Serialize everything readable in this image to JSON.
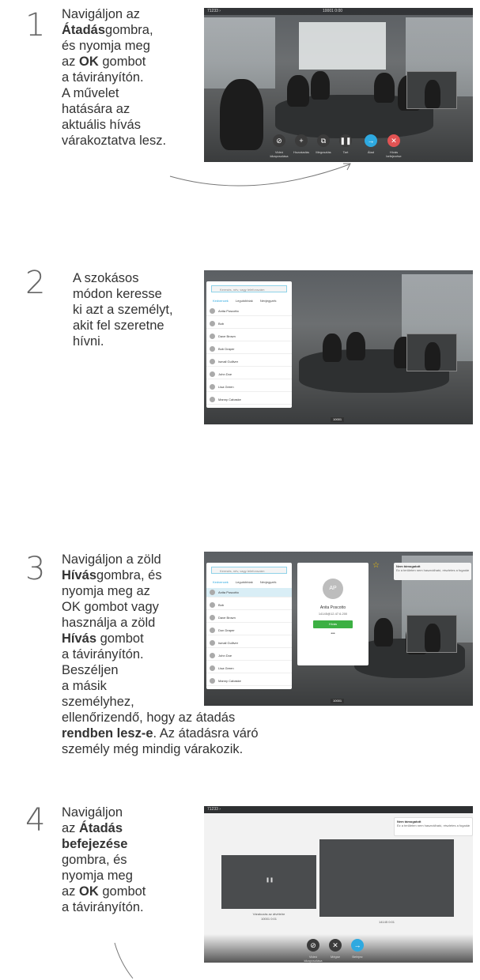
{
  "steps": [
    {
      "number": "1",
      "lines": [
        "Navigáljon az",
        "Átadásgombra,",
        "és nyomja meg",
        "az OK gombot",
        "a távirányítón.",
        "A művelet",
        "hatására az",
        "aktuális hívás",
        "várakoztatva lesz."
      ],
      "bold": {
        "l1": "Átadás",
        "l1rest": "gombra,",
        "l3pre": "az ",
        "l3b": "OK",
        "l3post": " gombot"
      },
      "screen": {
        "top_left": "71233 ›",
        "top_center": "10001  0:00",
        "controls": [
          "Videó kikapcsolása",
          "Hozzáadás",
          "Megosztás",
          "Tart",
          "Átad",
          "Hívás befejezése"
        ]
      }
    },
    {
      "number": "2",
      "lines": [
        "A szokásos",
        "módon keresse",
        "ki azt a személyt,",
        "akit fel szeretne",
        "hívni."
      ],
      "screen": {
        "search_placeholder": "Keresés, név, vagy telefonszám",
        "tabs": [
          "Kedvencek",
          "Legutóbbiak",
          "Névjegyzék"
        ],
        "contacts": [
          "Anita Poscotto",
          "Bob",
          "Dave Brown",
          "Bob Draper",
          "Ismail Gulliver",
          "John Doe",
          "Lisa Green",
          "Manny Cabaske"
        ],
        "bottom_tag": "10001"
      }
    },
    {
      "number": "3",
      "lines": [
        "Navigáljon a zöld",
        "Hívásgombra, és",
        "nyomja meg az",
        "OK gombot vagy",
        "használja a zöld",
        "Hívás gombot",
        "a távirányítón.",
        "Beszéljen",
        "a másik",
        "személyhez,",
        "ellenőrizendő, hogy az átadás",
        "rendben lesz-e. Az átadásra váró",
        "személy még mindig várakozik."
      ],
      "bold": {
        "l1": "Hívás",
        "l1rest": "gombra, és",
        "l5": "Hívás",
        "l5rest": " gombot",
        "l11b": "rendben lesz-e",
        "l11rest": ". Az átadásra váró"
      },
      "screen": {
        "search_placeholder": "Keresés, név, vagy telefonszám",
        "tabs": [
          "Kedvencek",
          "Legutóbbiak",
          "Névjegyzék"
        ],
        "contacts": [
          "Anita Poscotto",
          "Bob",
          "Dave Brown",
          "Don Draper",
          "Ismail Gulliver",
          "John Doe",
          "Lisa Green",
          "Manny Cabaske"
        ],
        "card_initials": "AP",
        "card_name": "Anita Poscotto",
        "card_number": "14145@12.47.6.200",
        "card_call": "Hívás",
        "card_more": "•••",
        "notice_title": "Nem támogatott",
        "notice_text": "Ez a területen nem használható, részletes a fogadási módok, a FIKB-vá",
        "bottom_tag": "10001"
      }
    },
    {
      "number": "4",
      "lines": [
        "Navigáljon",
        "az Átadás",
        "befejezése",
        "gombra, és",
        "nyomja meg",
        "az OK gombot",
        "a távirányítón."
      ],
      "bold": {
        "l1pre": "az ",
        "l1b": "Átadás",
        "l2": "befejezése",
        "l5pre": "az ",
        "l5b": "OK",
        "l5post": " gombot"
      },
      "screen": {
        "top_left": "71233 ›",
        "notice_title": "Nem támogatott",
        "notice_text": "Ez a területen nem használható, részletes a fogadási módok, a FIKB-vá",
        "left_label": "Várakozás az átvételre",
        "left_sub": "10001  0:01",
        "right_sub": "14145  0:01",
        "controls": [
          "Videó kikapcsolása",
          "Mégse",
          "Befejez"
        ]
      }
    }
  ]
}
